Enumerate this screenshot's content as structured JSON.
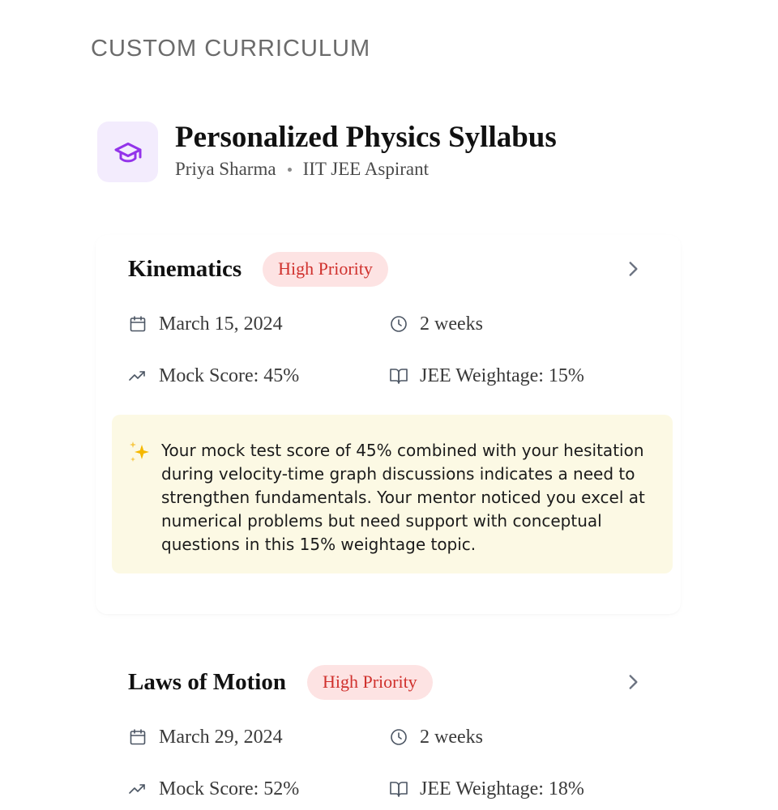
{
  "section_label": "CUSTOM CURRICULUM",
  "header": {
    "title": "Personalized Physics Syllabus",
    "student_name": "Priya Sharma",
    "student_goal": "IIT JEE Aspirant",
    "icon": "graduation-cap-icon",
    "accent_color": "#9333ea"
  },
  "topics": [
    {
      "name": "Kinematics",
      "priority": "High Priority",
      "date": "March 15, 2024",
      "duration": "2 weeks",
      "mock_score": "Mock Score: 45%",
      "jee_weightage": "JEE Weightage: 15%",
      "insight": "Your mock test score of 45% combined with your hesitation during velocity-time graph discussions indicates a need to strengthen fundamentals. Your mentor noticed you excel at numerical problems but need support with conceptual questions in this 15% weightage topic."
    },
    {
      "name": "Laws of Motion",
      "priority": "High Priority",
      "date": "March 29, 2024",
      "duration": "2 weeks",
      "mock_score": "Mock Score: 52%",
      "jee_weightage": "JEE Weightage: 18%"
    }
  ],
  "colors": {
    "priority_bg": "#fde3e3",
    "priority_text": "#d0312d",
    "insight_bg": "#fcf9e4"
  }
}
